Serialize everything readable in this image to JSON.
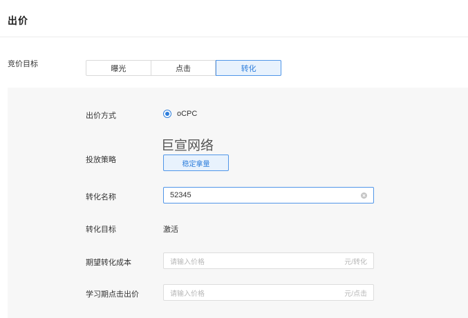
{
  "header": {
    "title": "出价"
  },
  "bid_target": {
    "label": "竞价目标",
    "options": [
      "曝光",
      "点击",
      "转化"
    ],
    "selected": "转化"
  },
  "form": {
    "bid_method": {
      "label": "出价方式",
      "option": "oCPC",
      "checked": true
    },
    "watermark": "巨宣网络",
    "strategy": {
      "label": "投放策略",
      "button": "稳定拿量"
    },
    "conversion_name": {
      "label": "转化名称",
      "value": "52345"
    },
    "conversion_target": {
      "label": "转化目标",
      "value": "激活"
    },
    "expected_cost": {
      "label": "期望转化成本",
      "placeholder": "请输入价格",
      "suffix": "元/转化"
    },
    "learning_bid": {
      "label": "学习期点击出价",
      "placeholder": "请输入价格",
      "suffix": "元/点击"
    }
  },
  "colors": {
    "accent": "#2f7fdc",
    "accent_bg": "#e8f2fd",
    "panel_bg": "#f7f7f7"
  }
}
